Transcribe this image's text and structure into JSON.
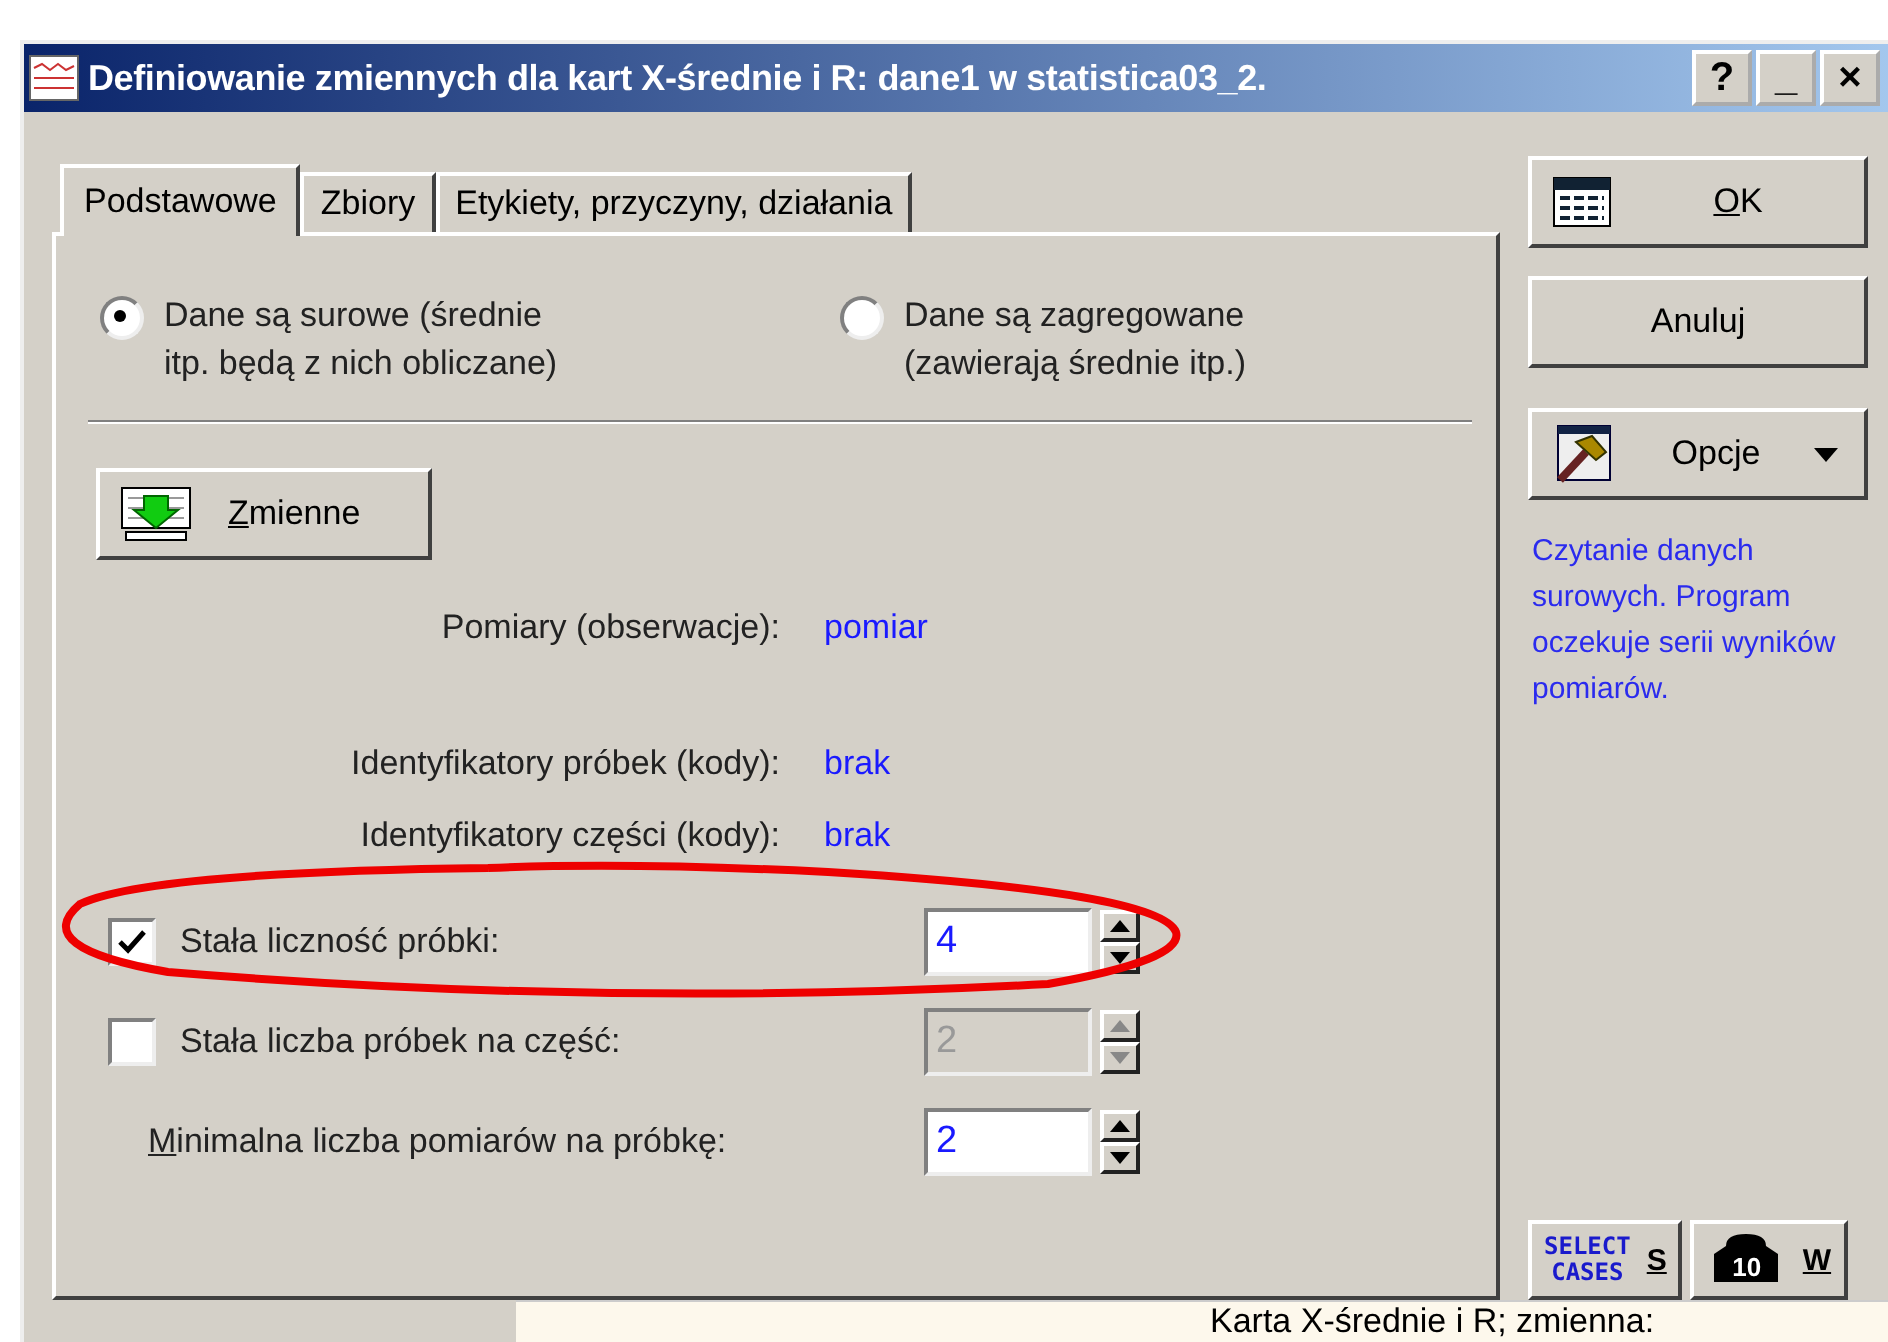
{
  "window": {
    "title": "Definiowanie zmiennych dla kart X-średnie i R: dane1 w statistica03_2.",
    "controls": [
      "?",
      "_",
      "×"
    ]
  },
  "tabs": [
    {
      "label": "Podstawowe",
      "selected": true
    },
    {
      "label": "Zbiory",
      "selected": false
    },
    {
      "label": "Etykiety, przyczyny, działania",
      "selected": false
    }
  ],
  "data_mode": [
    {
      "lines": [
        "Dane są surowe (średnie",
        "itp. będą z nich obliczane)"
      ],
      "selected": true
    },
    {
      "lines": [
        "Dane są zagregowane",
        "(zawierają średnie itp.)"
      ],
      "selected": false
    }
  ],
  "variables_button": {
    "label": "Zmienne"
  },
  "variables": [
    {
      "label": "Pomiary (obserwacje):",
      "value": "pomiar"
    },
    {
      "label": "Identyfikatory próbek (kody):",
      "value": "brak"
    },
    {
      "label": "Identyfikatory części (kody):",
      "value": "brak"
    }
  ],
  "options": [
    {
      "kind": "checkbox",
      "label": "Stała liczność próbki:",
      "checked": true,
      "value": "4",
      "disabled": false
    },
    {
      "kind": "checkbox",
      "label": "Stała liczba próbek na część:",
      "checked": false,
      "value": "2",
      "disabled": true
    },
    {
      "kind": "plain",
      "label": "Minimalna liczba pomiarów na próbkę:",
      "value": "2",
      "disabled": false
    }
  ],
  "buttons": [
    {
      "kind": "ok",
      "label": "OK"
    },
    {
      "kind": "plain",
      "label": "Anuluj"
    },
    {
      "kind": "options",
      "label": "Opcje"
    }
  ],
  "hint": "Czytanie danych surowych. Program oczekuje serii wyników pomiarów.",
  "tool_buttons": [
    {
      "kind": "select",
      "icon_text": [
        "SELECT",
        "CASES"
      ],
      "label": "S"
    },
    {
      "kind": "weight",
      "icon_text": [
        "10"
      ],
      "label": "W"
    }
  ],
  "background_window": {
    "text": "Karta X-średnie i R; zmienna:"
  }
}
